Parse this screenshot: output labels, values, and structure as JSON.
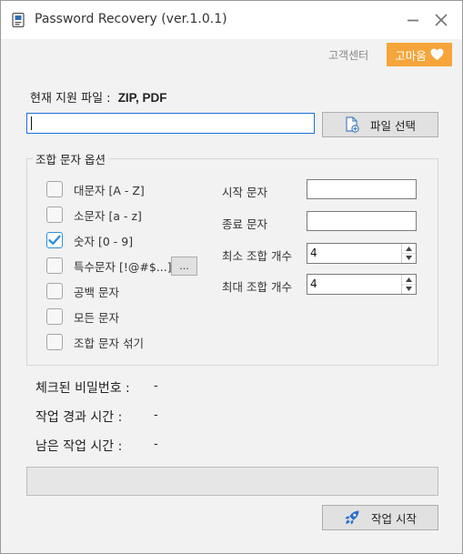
{
  "window": {
    "title": "Password Recovery (ver.1.0.1)"
  },
  "header": {
    "support_label": "고객센터",
    "thanks_label": "고마움"
  },
  "file": {
    "supported_label": "현재 지원 파일 :",
    "supported_types": "ZIP, PDF",
    "path_value": "",
    "select_button_label": "파일 선택"
  },
  "options": {
    "group_title": "조합 문자 옵션",
    "charsets": [
      {
        "label": "대문자 [A - Z]",
        "checked": false
      },
      {
        "label": "소문자 [a - z]",
        "checked": false
      },
      {
        "label": "숫자 [0 - 9]",
        "checked": true
      },
      {
        "label": "특수문자 [!@#$...]",
        "checked": false
      },
      {
        "label": "공백 문자",
        "checked": false
      },
      {
        "label": "모든 문자",
        "checked": false
      },
      {
        "label": "조합 문자 섞기",
        "checked": false
      }
    ],
    "special_chars_button_label": "...",
    "start_char_label": "시작 문자",
    "start_char_value": "",
    "end_char_label": "종료 문자",
    "end_char_value": "",
    "min_count_label": "최소 조합 개수",
    "min_count_value": "4",
    "max_count_label": "최대 조합 개수",
    "max_count_value": "4"
  },
  "status": {
    "checked_label": "체크된 비밀번호 :",
    "checked_value": "-",
    "elapsed_label": "작업 경과 시간 :",
    "elapsed_value": "-",
    "remaining_label": "남은 작업 시간 :",
    "remaining_value": "-",
    "progress_fraction": 0
  },
  "actions": {
    "start_button_label": "작업 시작"
  },
  "colors": {
    "accent_orange": "#f5a53a",
    "focus_blue": "#1e6fd9",
    "check_blue": "#2b8ee0",
    "panel_bg": "#f2f2f2"
  },
  "icons": {
    "app": "app-document-icon",
    "minimize": "minimize-icon",
    "close": "close-icon",
    "heart": "heart-icon",
    "file_add": "file-add-icon",
    "rocket": "rocket-icon"
  }
}
